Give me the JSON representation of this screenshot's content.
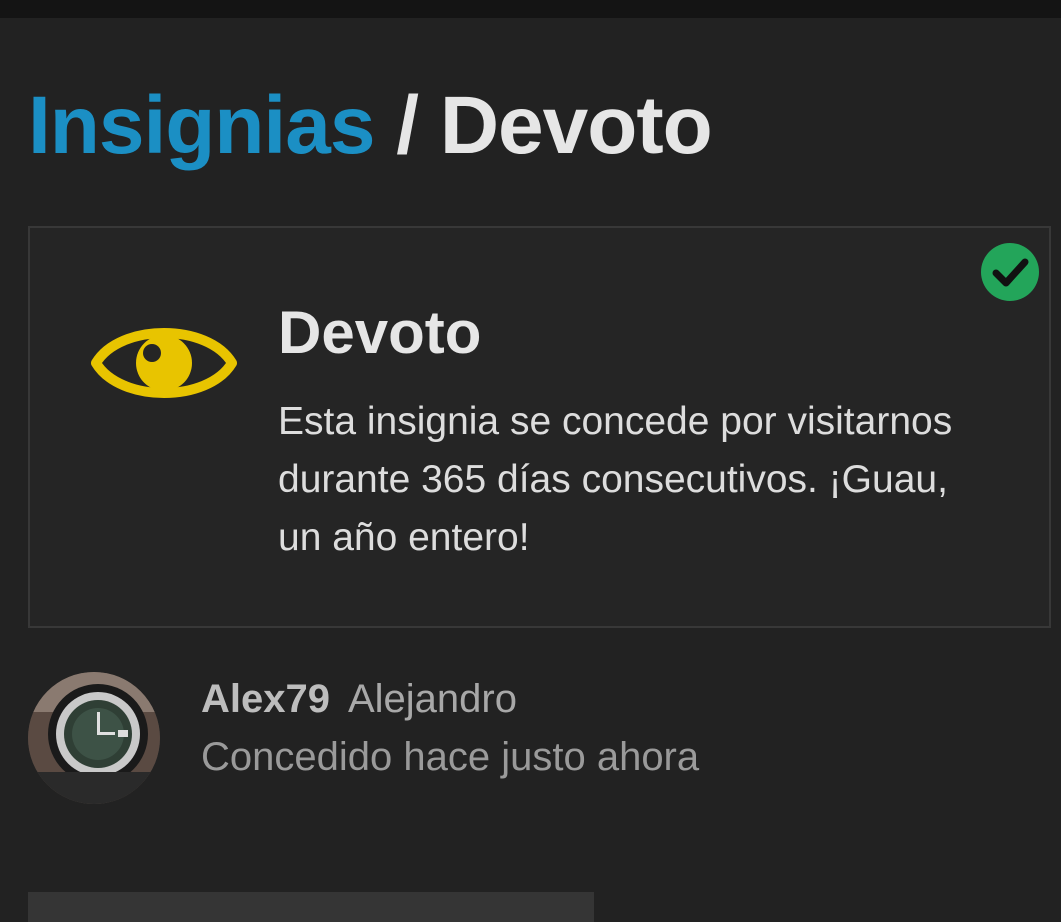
{
  "breadcrumb": {
    "parent_label": "Insignias",
    "separator": "/",
    "current_label": "Devoto"
  },
  "badge": {
    "name": "Devoto",
    "description": "Esta insignia se concede por visitarnos durante 365 días consecutivos. ¡Guau, un año entero!",
    "icon": "eye-icon",
    "icon_color": "#e8c400",
    "granted_icon": "check-circle-icon",
    "granted_color": "#23a55a"
  },
  "grant": {
    "username": "Alex79",
    "full_name": "Alejandro",
    "granted_text": "Concedido hace justo ahora"
  },
  "colors": {
    "accent": "#1b8fc4",
    "background": "#222222",
    "card_border": "#383838"
  }
}
